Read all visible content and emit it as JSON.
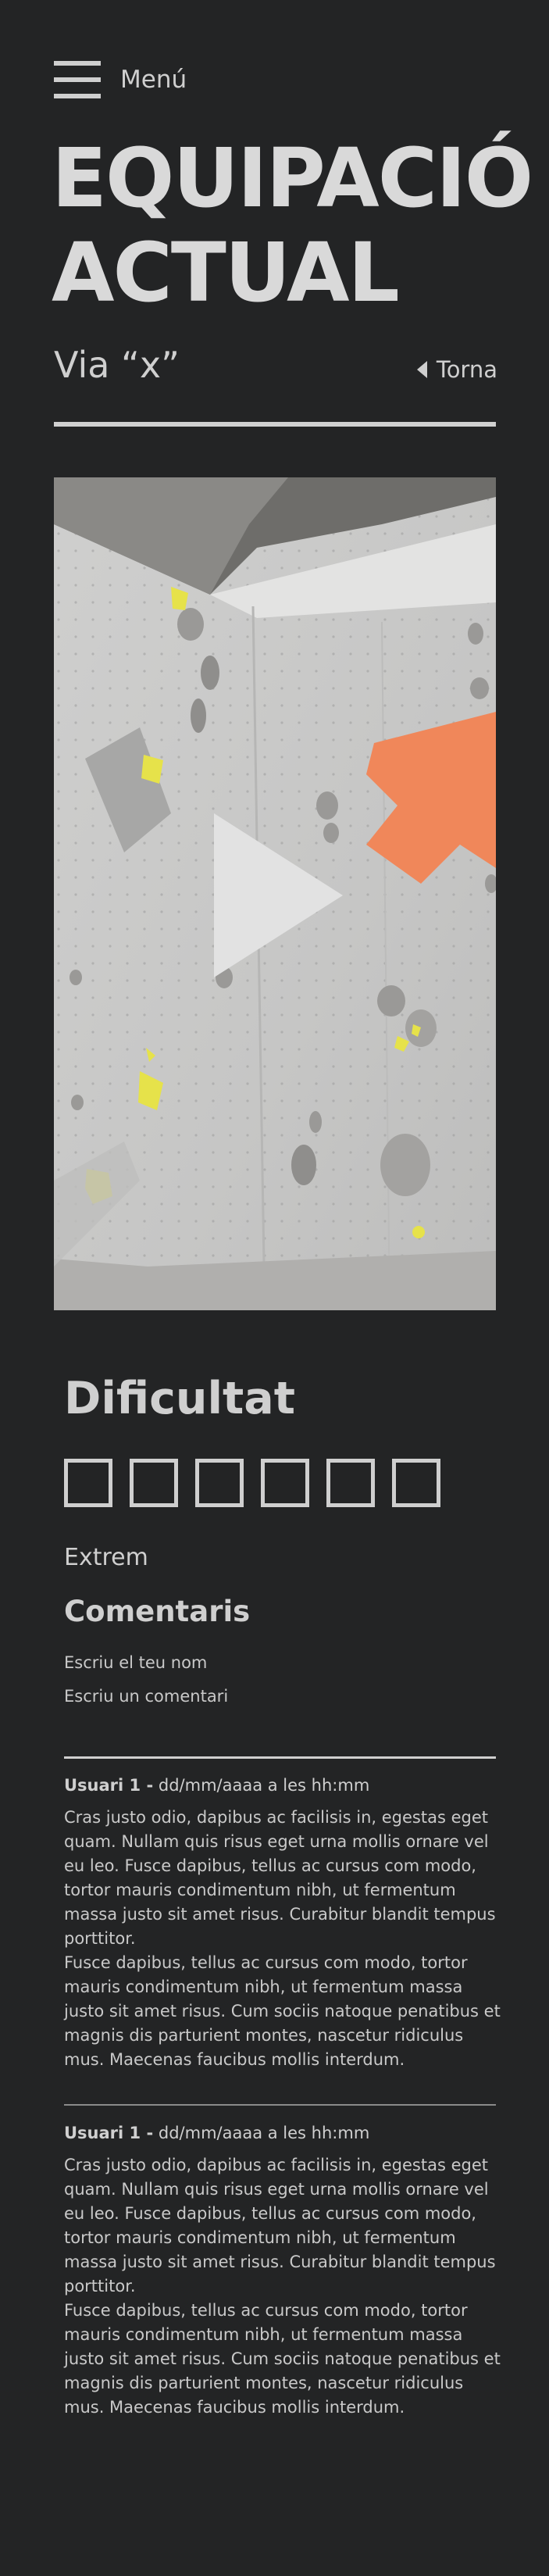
{
  "header": {
    "menu_label": "Menú",
    "title_line1": "EQUIPACIÓ",
    "title_line2": "ACTUAL",
    "route": "Via “x”",
    "back_label": "Torna"
  },
  "difficulty": {
    "heading": "Dificultat",
    "scale_count": 6,
    "level_label": "Extrem"
  },
  "comments": {
    "heading": "Comentaris",
    "name_placeholder": "Escriu el teu nom",
    "comment_placeholder": "Escriu un comentari",
    "items": [
      {
        "user": "Usuari 1 -",
        "meta": "dd/mm/aaaa a les hh:mm",
        "para1": "Cras justo odio, dapibus ac facilisis in, egestas eget quam. Nullam quis risus eget urna mollis ornare vel eu leo. Fusce dapibus, tellus ac cursus com modo, tortor mauris condimentum nibh, ut fermentum massa justo sit amet risus. Curabitur blandit tempus porttitor.",
        "para2": "Fusce dapibus, tellus ac cursus com modo, tortor mauris condimentum nibh, ut fermentum massa justo sit amet risus. Cum sociis natoque penatibus et magnis dis parturient montes, nascetur ridiculus mus. Maecenas faucibus mollis interdum."
      },
      {
        "user": "Usuari 1 -",
        "meta": "dd/mm/aaaa a les hh:mm",
        "para1": "Cras justo odio, dapibus ac facilisis in, egestas eget quam. Nullam quis risus eget urna mollis ornare vel eu leo. Fusce dapibus, tellus ac cursus com modo, tortor mauris condimentum nibh, ut fermentum massa justo sit amet risus. Curabitur blandit tempus porttitor.",
        "para2": "Fusce dapibus, tellus ac cursus com modo, tortor mauris condimentum nibh, ut fermentum massa justo sit amet risus. Cum sociis natoque penatibus et magnis dis parturient montes, nascetur ridiculus mus. Maecenas faucibus mollis interdum."
      }
    ]
  },
  "colors": {
    "background": "#232425",
    "text": "#d0d0d0",
    "accent_orange": "#f0875a",
    "hold_yellow": "#e6e24a"
  }
}
